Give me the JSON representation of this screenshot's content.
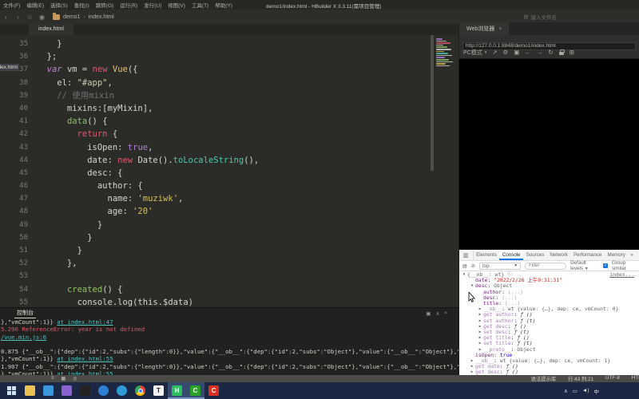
{
  "title_bar": {
    "menus": [
      "文件(F)",
      "编辑(E)",
      "选择(S)",
      "查找(I)",
      "跳转(G)",
      "运行(R)",
      "发行(U)",
      "视图(V)",
      "工具(T)",
      "帮助(Y)"
    ],
    "title": "demo1/index.html - HBuilder X 3.3.11(需项目管理)"
  },
  "toolbar": {
    "breadcrumb": {
      "project": "demo1",
      "sep": "›",
      "file": "index.html"
    },
    "file_search": "键入文件名"
  },
  "editor": {
    "tab": "index.html",
    "side_label": "index.html",
    "lines": [
      {
        "n": "35",
        "seg": [
          {
            "c": "pl",
            "t": "    }"
          }
        ]
      },
      {
        "n": "36",
        "seg": [
          {
            "c": "pl",
            "t": "  };"
          }
        ]
      },
      {
        "n": "37",
        "seg": [
          {
            "c": "pl",
            "t": "  "
          },
          {
            "c": "kw",
            "t": "var"
          },
          {
            "c": "pl",
            "t": " vm "
          },
          {
            "c": "op",
            "t": "="
          },
          {
            "c": "pl",
            "t": " "
          },
          {
            "c": "kw2",
            "t": "new"
          },
          {
            "c": "pl",
            "t": " "
          },
          {
            "c": "type",
            "t": "Vue"
          },
          {
            "c": "pl",
            "t": "({"
          }
        ]
      },
      {
        "n": "38",
        "seg": [
          {
            "c": "pl",
            "t": "    el: "
          },
          {
            "c": "str2",
            "t": "\"#app\""
          },
          {
            "c": "pl",
            "t": ","
          }
        ]
      },
      {
        "n": "39",
        "seg": [
          {
            "c": "cm",
            "t": "    // 使用mixin"
          }
        ]
      },
      {
        "n": "40",
        "seg": [
          {
            "c": "pl",
            "t": "      mixins:[myMixin],"
          }
        ]
      },
      {
        "n": "41",
        "seg": [
          {
            "c": "pl",
            "t": "      "
          },
          {
            "c": "fn",
            "t": "data"
          },
          {
            "c": "pl",
            "t": "() {"
          }
        ]
      },
      {
        "n": "42",
        "seg": [
          {
            "c": "pl",
            "t": "        "
          },
          {
            "c": "kw2",
            "t": "return"
          },
          {
            "c": "pl",
            "t": " {"
          }
        ]
      },
      {
        "n": "43",
        "seg": [
          {
            "c": "pl",
            "t": "          isOpen: "
          },
          {
            "c": "bool",
            "t": "true"
          },
          {
            "c": "pl",
            "t": ","
          }
        ]
      },
      {
        "n": "44",
        "seg": [
          {
            "c": "pl",
            "t": "          date: "
          },
          {
            "c": "kw2",
            "t": "new"
          },
          {
            "c": "pl",
            "t": " Date()."
          },
          {
            "c": "meth",
            "t": "toLocaleString"
          },
          {
            "c": "pl",
            "t": "(),"
          }
        ]
      },
      {
        "n": "45",
        "seg": [
          {
            "c": "pl",
            "t": "          desc: {"
          }
        ]
      },
      {
        "n": "46",
        "seg": [
          {
            "c": "pl",
            "t": "            author: {"
          }
        ]
      },
      {
        "n": "47",
        "seg": [
          {
            "c": "pl",
            "t": "              name: "
          },
          {
            "c": "str",
            "t": "'muziwk'"
          },
          {
            "c": "pl",
            "t": ","
          }
        ]
      },
      {
        "n": "48",
        "seg": [
          {
            "c": "pl",
            "t": "              age: "
          },
          {
            "c": "str",
            "t": "'20'"
          }
        ]
      },
      {
        "n": "49",
        "seg": [
          {
            "c": "pl",
            "t": "            }"
          }
        ]
      },
      {
        "n": "50",
        "seg": [
          {
            "c": "pl",
            "t": "          }"
          }
        ]
      },
      {
        "n": "51",
        "seg": [
          {
            "c": "pl",
            "t": "        }"
          }
        ]
      },
      {
        "n": "52",
        "seg": [
          {
            "c": "pl",
            "t": "      },"
          }
        ]
      },
      {
        "n": "53",
        "seg": []
      },
      {
        "n": "54",
        "seg": [
          {
            "c": "pl",
            "t": "      "
          },
          {
            "c": "fn",
            "t": "created"
          },
          {
            "c": "pl",
            "t": "() {"
          }
        ]
      },
      {
        "n": "55",
        "seg": [
          {
            "c": "pl",
            "t": "        console.log(this.$data)"
          }
        ]
      }
    ]
  },
  "hb_console": {
    "tab": "控制台",
    "lines": [
      {
        "seg": [
          {
            "c": "t",
            "t": "},\"vmCount\":1}} "
          },
          {
            "c": "lnk",
            "t": "at index.html:47"
          }
        ]
      },
      {
        "seg": [
          {
            "c": "err",
            "t": "5.296 ReferenceError: year is not defined"
          }
        ]
      },
      {
        "seg": [
          {
            "c": "lnk",
            "t": "/vue.min.js:6"
          }
        ]
      },
      {
        "seg": []
      },
      {
        "seg": [
          {
            "c": "t",
            "t": "0.875 {\"__ob__\":{\"dep\":{\"id\":2,\"subs\":{\"length\":0}},\"value\":{\"__ob__\":{\"dep\":{\"id\":2,\"subs\":\"Object\"},\"value\":{\"__ob__\":\"Object\"},\"vmCo"
          }
        ]
      },
      {
        "seg": [
          {
            "c": "t",
            "t": "},\"vmCount\":1}} "
          },
          {
            "c": "lnk",
            "t": "at index.html:55"
          }
        ]
      },
      {
        "seg": [
          {
            "c": "t",
            "t": "1.907 {\"__ob__\":{\"dep\":{\"id\":2,\"subs\":{\"length\":0}},\"value\":{\"__ob__\":{\"dep\":{\"id\":2,\"subs\":\"Object\"},\"value\":{\"__ob__\":\"Object\"},\"vmCo"
          }
        ]
      },
      {
        "seg": [
          {
            "c": "t",
            "t": "},\"vmCount\":1}} "
          },
          {
            "c": "lnk",
            "t": "at index.html:55"
          }
        ]
      }
    ]
  },
  "browser": {
    "tab": "Web浏览器",
    "close": "×",
    "url": "http://127.0.0.1:8848/demo1/index.html",
    "mode": "PC模式"
  },
  "devtools": {
    "tabs": [
      "Elements",
      "Console",
      "Sources",
      "Network",
      "Performance",
      "Memory"
    ],
    "active": "Console",
    "more": "»",
    "context": "top",
    "filter_placeholder": "Filter",
    "levels": "Default levels",
    "group": "Group similar",
    "rows": [
      {
        "ind": 0,
        "arrow": "▼",
        "seg": [
          {
            "c": "obj",
            "t": "{__ob__: wt} "
          },
          {
            "c": "info",
            "t": "ⓘ"
          }
        ],
        "link": "index..."
      },
      {
        "ind": 1,
        "arrow": "",
        "seg": [
          {
            "c": "key",
            "t": "date"
          },
          {
            "c": "pl",
            "t": ": "
          },
          {
            "c": "str",
            "t": "\"2022/2/26 上午9:31:31\""
          }
        ]
      },
      {
        "ind": 1,
        "arrow": "▼",
        "seg": [
          {
            "c": "key",
            "t": "desc"
          },
          {
            "c": "pl",
            "t": ": "
          },
          {
            "c": "obj",
            "t": "Object"
          }
        ]
      },
      {
        "ind": 2,
        "arrow": "",
        "seg": [
          {
            "c": "key",
            "t": "author"
          },
          {
            "c": "pl",
            "t": ": "
          },
          {
            "c": "dim",
            "t": "(...)"
          }
        ]
      },
      {
        "ind": 2,
        "arrow": "",
        "seg": [
          {
            "c": "key",
            "t": "desc"
          },
          {
            "c": "pl",
            "t": ": "
          },
          {
            "c": "dim",
            "t": "(...)"
          }
        ]
      },
      {
        "ind": 2,
        "arrow": "",
        "seg": [
          {
            "c": "key",
            "t": "title"
          },
          {
            "c": "pl",
            "t": ": "
          },
          {
            "c": "dim",
            "t": "(...)"
          }
        ]
      },
      {
        "ind": 2,
        "arrow": "▶",
        "seg": [
          {
            "c": "dkey",
            "t": "__ob__"
          },
          {
            "c": "pl",
            "t": ": "
          },
          {
            "c": "obj",
            "t": "wt {value: {…}, dep: ce, vmCount: 0}"
          }
        ]
      },
      {
        "ind": 2,
        "arrow": "▶",
        "seg": [
          {
            "c": "dkey",
            "t": "get author"
          },
          {
            "c": "pl",
            "t": ": "
          },
          {
            "c": "fnv",
            "t": "ƒ ()"
          }
        ]
      },
      {
        "ind": 2,
        "arrow": "▶",
        "seg": [
          {
            "c": "dkey",
            "t": "set author"
          },
          {
            "c": "pl",
            "t": ": "
          },
          {
            "c": "fnv",
            "t": "ƒ (t)"
          }
        ]
      },
      {
        "ind": 2,
        "arrow": "▶",
        "seg": [
          {
            "c": "dkey",
            "t": "get desc"
          },
          {
            "c": "pl",
            "t": ": "
          },
          {
            "c": "fnv",
            "t": "ƒ ()"
          }
        ]
      },
      {
        "ind": 2,
        "arrow": "▶",
        "seg": [
          {
            "c": "dkey",
            "t": "set desc"
          },
          {
            "c": "pl",
            "t": ": "
          },
          {
            "c": "fnv",
            "t": "ƒ (t)"
          }
        ]
      },
      {
        "ind": 2,
        "arrow": "▶",
        "seg": [
          {
            "c": "dkey",
            "t": "get title"
          },
          {
            "c": "pl",
            "t": ": "
          },
          {
            "c": "fnv",
            "t": "ƒ ()"
          }
        ]
      },
      {
        "ind": 2,
        "arrow": "▶",
        "seg": [
          {
            "c": "dkey",
            "t": "set title"
          },
          {
            "c": "pl",
            "t": ": "
          },
          {
            "c": "fnv",
            "t": "ƒ (t)"
          }
        ]
      },
      {
        "ind": 2,
        "arrow": "▶",
        "seg": [
          {
            "c": "dkey",
            "t": "__proto__"
          },
          {
            "c": "pl",
            "t": ": "
          },
          {
            "c": "obj",
            "t": "Object"
          }
        ]
      },
      {
        "ind": 1,
        "arrow": "",
        "seg": [
          {
            "c": "key",
            "t": "isOpen"
          },
          {
            "c": "pl",
            "t": ": "
          },
          {
            "c": "bool",
            "t": "true"
          }
        ]
      },
      {
        "ind": 1,
        "arrow": "▶",
        "seg": [
          {
            "c": "dkey",
            "t": "__ob__"
          },
          {
            "c": "pl",
            "t": ": "
          },
          {
            "c": "obj",
            "t": "wt {value: {…}, dep: ce, vmCount: 1}"
          }
        ]
      },
      {
        "ind": 1,
        "arrow": "▶",
        "seg": [
          {
            "c": "dkey",
            "t": "get date"
          },
          {
            "c": "pl",
            "t": ": "
          },
          {
            "c": "fnv",
            "t": "ƒ ()"
          }
        ]
      },
      {
        "ind": 1,
        "arrow": "▶",
        "seg": [
          {
            "c": "dkey",
            "t": "get desc"
          },
          {
            "c": "pl",
            "t": ": "
          },
          {
            "c": "fnv",
            "t": "ƒ ()"
          }
        ]
      }
    ]
  },
  "status_bar": {
    "items": [
      "语法提示库",
      "行:43 列:21",
      "UTF-8",
      "HTML"
    ]
  },
  "taskbar": {
    "apps": [
      {
        "name": "start-button",
        "type": "start"
      },
      {
        "name": "file-explorer-icon",
        "color": "#eac253"
      },
      {
        "name": "photos-icon",
        "color": "#3a96dd"
      },
      {
        "name": "3d-viewer-icon",
        "color": "#8a63d2"
      },
      {
        "name": "media-player-icon",
        "color": "#232323"
      },
      {
        "name": "app-blue-icon",
        "color": "#2f7fd6",
        "round": true
      },
      {
        "name": "edge-icon",
        "color": "#2e9bd6",
        "round": true
      },
      {
        "name": "chrome-icon",
        "type": "chrome",
        "round": true
      },
      {
        "name": "typora-icon",
        "color": "#f2f2f2",
        "glyph": "T",
        "fg": "#222222"
      },
      {
        "name": "hbuilderx-icon",
        "color": "#2dbe60",
        "glyph": "H",
        "active": true
      },
      {
        "name": "c-green-app-icon",
        "color": "#27a327",
        "glyph": "C",
        "active": true
      },
      {
        "name": "c-red-app-icon",
        "color": "#d93025",
        "glyph": "C"
      }
    ],
    "tray": [
      {
        "name": "chevron-up-icon",
        "glyph": "∧"
      },
      {
        "name": "display-icon",
        "glyph": "▭"
      },
      {
        "name": "volume-icon",
        "glyph": "◄)"
      },
      {
        "name": "ime-indicator",
        "glyph": "中"
      }
    ]
  },
  "colors": {
    "accent": "#1a73e8",
    "console_link": "#4dc4c4",
    "error": "#e0596e",
    "hbuilder_green": "#2dbe60"
  }
}
